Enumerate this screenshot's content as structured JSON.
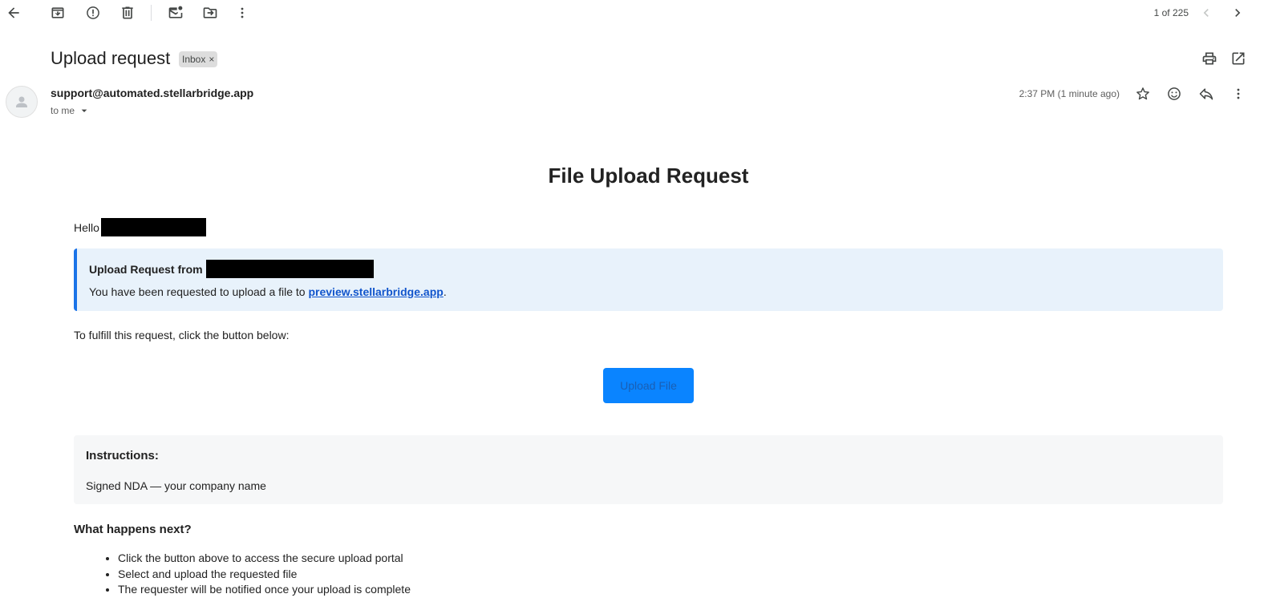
{
  "toolbar": {
    "icons": [
      "back-arrow-icon",
      "archive-icon",
      "report-spam-icon",
      "delete-icon",
      "mark-unread-icon",
      "move-to-icon",
      "more-vert-icon"
    ]
  },
  "pager": {
    "text": "1 of 225"
  },
  "email": {
    "subject": "Upload request",
    "label": "Inbox",
    "label_remove": "×",
    "sender": "support@automated.stellarbridge.app",
    "to": "to me",
    "timestamp": "2:37 PM (1 minute ago)"
  },
  "body": {
    "title": "File Upload Request",
    "greeting": "Hello",
    "callout_title": "Upload Request from",
    "callout_text": "You have been requested to upload a file to ",
    "callout_link": "preview.stellarbridge.app",
    "callout_period": ".",
    "fulfill_text": "To fulfill this request, click the button below:",
    "upload_button": "Upload File",
    "instructions_title": "Instructions:",
    "instructions_text": "Signed NDA — your company name",
    "next_title": "What happens next?",
    "next_steps": [
      "Click the button above to access the secure upload portal",
      "Select and upload the requested file",
      "The requester will be notified once your upload is complete"
    ]
  },
  "colors": {
    "accent": "#1a73e8",
    "button": "#0a84ff",
    "callout_bg": "#e8f2fb",
    "instructions_bg": "#f6f7f8",
    "link": "#1155cc"
  }
}
